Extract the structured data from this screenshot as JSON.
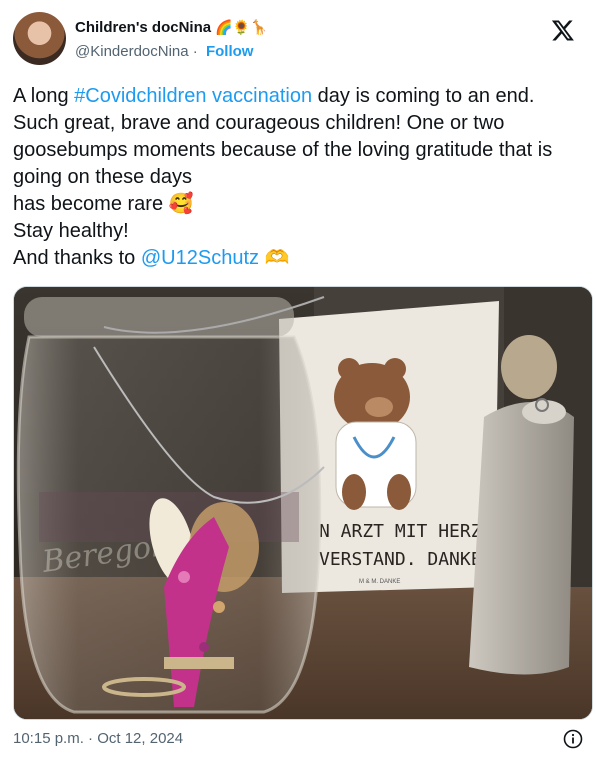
{
  "author": {
    "display_name": "Children's docNina",
    "name_emojis": "🌈🌻🦒",
    "handle": "@KinderdocNina",
    "separator": "·",
    "follow_label": "Follow"
  },
  "tweet": {
    "line1_pre": "A long ",
    "hashtag": "#Covidchildren vaccination",
    "line1_post": " day is coming to an end. Such great, brave and courageous children! One or two goosebumps moments because of the loving gratitude that is going on these days",
    "line2": "has become rare",
    "line2_emoji": "🥰",
    "line3": "Stay healthy!",
    "line4_pre": "And thanks to ",
    "mention": "@U12Schutz",
    "line4_emoji": "🫶"
  },
  "photo": {
    "card_line1": "N ARZT MIT HERZ",
    "card_line2": "VERSTAND. DANKE",
    "card_small": "M & M. DANKE",
    "jar_text": "Beregola"
  },
  "timestamp": "10:15 p.m. · Oct 12, 2024",
  "icons": {
    "logo": "x-logo-icon",
    "info": "info-icon"
  }
}
